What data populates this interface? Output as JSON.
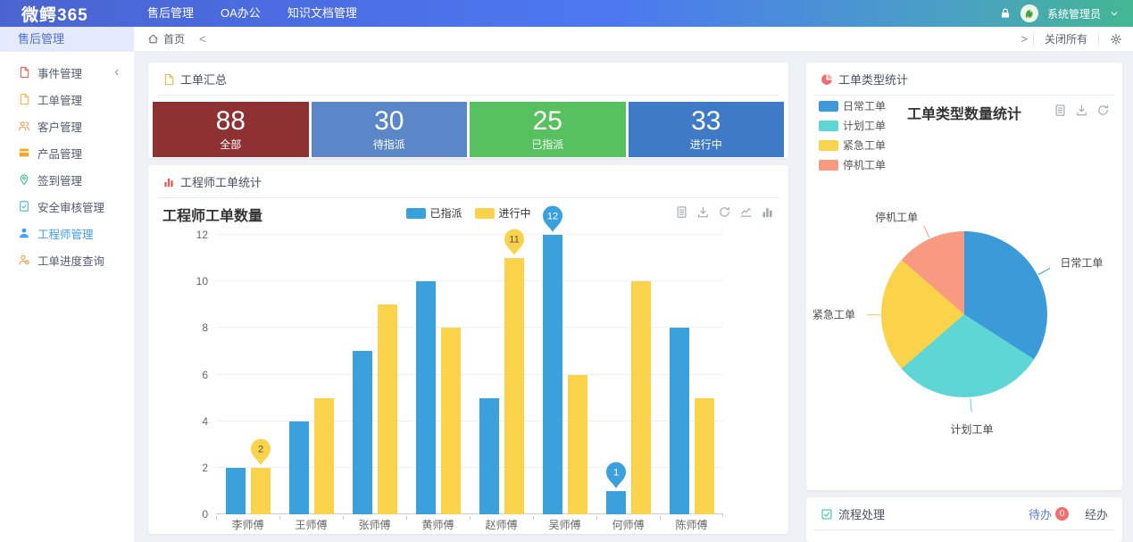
{
  "topbar": {
    "logo": "微鳄365",
    "menu": [
      {
        "label": "售后管理"
      },
      {
        "label": "OA办公"
      },
      {
        "label": "知识文档管理"
      }
    ],
    "user": "系统管理员",
    "icons": [
      "lock-icon",
      "avatar",
      "chevron-down-icon"
    ]
  },
  "sidebar": {
    "header": "售后管理",
    "items": [
      {
        "label": "事件管理",
        "icon": "file-icon",
        "icon_color": "#f2635f",
        "has_children": true
      },
      {
        "label": "工单管理",
        "icon": "file-icon",
        "icon_color": "#f7b84d"
      },
      {
        "label": "客户管理",
        "icon": "customers-icon",
        "icon_color": "#f09e56"
      },
      {
        "label": "产品管理",
        "icon": "product-icon",
        "icon_color": "#f5a623"
      },
      {
        "label": "签到管理",
        "icon": "checkin-icon",
        "icon_color": "#49bd8f"
      },
      {
        "label": "安全审核管理",
        "icon": "audit-icon",
        "icon_color": "#4fc6c0"
      },
      {
        "label": "工程师管理",
        "icon": "engineer-icon",
        "icon_color": "#409eff",
        "active": true
      },
      {
        "label": "工单进度查询",
        "icon": "progress-icon",
        "icon_color": "#f2a152"
      }
    ],
    "active_color": "#409eff"
  },
  "tagsbar": {
    "home_label": "首页",
    "scroll_left": "<",
    "scroll_right": ">",
    "close_all": "关闭所有",
    "icons": [
      "home-icon",
      "gear-icon"
    ]
  },
  "summary": {
    "header": "工单汇总",
    "header_icon_color": "#f7b84d",
    "stats": [
      {
        "value": "88",
        "label": "全部",
        "color": "#8e3133"
      },
      {
        "value": "30",
        "label": "待指派",
        "color": "#5b87c9"
      },
      {
        "value": "25",
        "label": "已指派",
        "color": "#57c05f"
      },
      {
        "value": "33",
        "label": "进行中",
        "color": "#3f7ac6"
      }
    ]
  },
  "engineer_card": {
    "header": "工程师工单统计",
    "header_icon_color": "#e35d5b",
    "toolbox": [
      "data-view-icon",
      "download-icon",
      "refresh-icon",
      "line-chart-icon",
      "bar-chart-icon"
    ]
  },
  "type_card": {
    "header": "工单类型统计",
    "header_icon_color": "#ef6a6a",
    "toolbox": [
      "data-view-icon",
      "download-icon",
      "refresh-icon"
    ]
  },
  "process_card": {
    "header": "流程处理",
    "header_icon_color": "#3ec3a6",
    "todo_label": "待办",
    "todo_count": "0",
    "todo_badge_color": "#f56c6c",
    "done_label": "经办"
  },
  "chart_data": [
    {
      "type": "bar",
      "title": "工程师工单数量",
      "categories": [
        "李师傅",
        "王师傅",
        "张师傅",
        "黄师傅",
        "赵师傅",
        "吴师傅",
        "何师傅",
        "陈师傅"
      ],
      "series": [
        {
          "name": "已指派",
          "color": "#3aa1dd",
          "values": [
            2,
            4,
            7,
            10,
            5,
            12,
            1,
            8
          ]
        },
        {
          "name": "进行中",
          "color": "#fbd34b",
          "values": [
            2,
            5,
            9,
            8,
            11,
            6,
            10,
            5
          ]
        }
      ],
      "ylim": [
        0,
        12
      ],
      "yticks": [
        0,
        2,
        4,
        6,
        8,
        10,
        12
      ],
      "grid": true,
      "legend_position": "top-center",
      "markpoints": [
        {
          "series": "已指派",
          "category": "吴师傅",
          "value": 12
        },
        {
          "series": "已指派",
          "category": "何师傅",
          "value": 1
        },
        {
          "series": "进行中",
          "category": "赵师傅",
          "value": 11
        },
        {
          "series": "进行中",
          "category": "李师傅",
          "value": 2
        }
      ]
    },
    {
      "type": "pie",
      "title": "工单类型数量统计",
      "labels": [
        "日常工单",
        "计划工单",
        "紧急工单",
        "停机工单"
      ],
      "values": [
        30,
        26,
        20,
        12
      ],
      "colors": [
        "#3b9ad8",
        "#5ed6d6",
        "#fbd34b",
        "#f89a82"
      ],
      "legend_position": "top-left"
    }
  ]
}
